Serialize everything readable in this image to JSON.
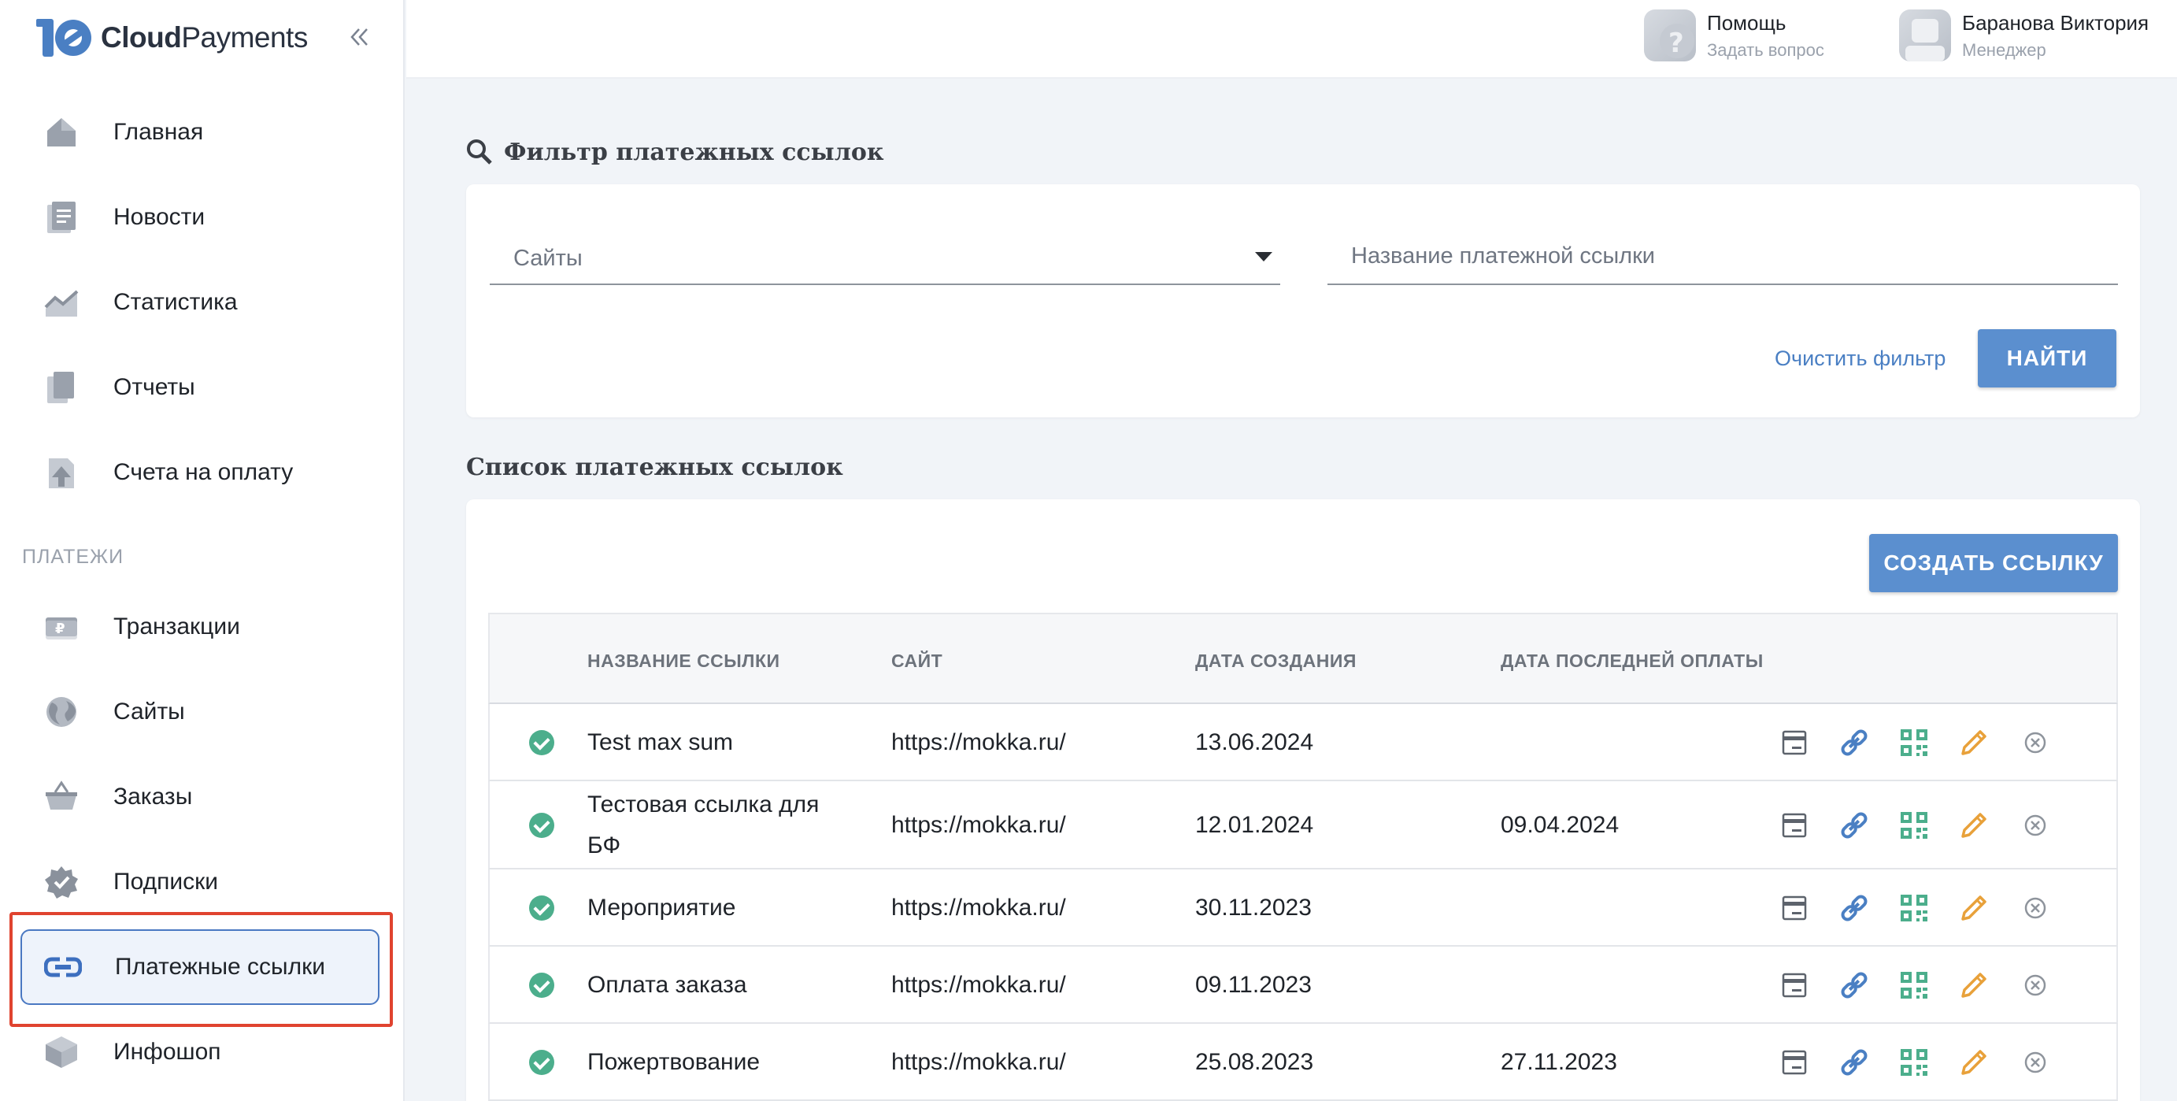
{
  "app": {
    "logo_bold": "Cloud",
    "logo_light": "Payments",
    "collapse_label": "«"
  },
  "sidebar": {
    "items_top": [
      {
        "label": "Главная",
        "icon": "home-icon"
      },
      {
        "label": "Новости",
        "icon": "news-icon"
      },
      {
        "label": "Статистика",
        "icon": "chart-icon"
      },
      {
        "label": "Отчеты",
        "icon": "reports-icon"
      },
      {
        "label": "Счета на оплату",
        "icon": "invoice-icon"
      }
    ],
    "section_payments": "ПЛАТЕЖИ",
    "items_payments": [
      {
        "label": "Транзакции",
        "icon": "transactions-icon"
      },
      {
        "label": "Сайты",
        "icon": "globe-icon"
      },
      {
        "label": "Заказы",
        "icon": "basket-icon"
      },
      {
        "label": "Подписки",
        "icon": "badge-icon"
      },
      {
        "label": "Платежные ссылки",
        "icon": "link-icon",
        "active": true
      },
      {
        "label": "Инфошоп",
        "icon": "box-icon"
      }
    ]
  },
  "topbar": {
    "help_title": "Помощь",
    "help_sub": "Задать вопрос",
    "user_name": "Баранова Виктория",
    "user_role": "Менеджер"
  },
  "filter": {
    "title": "Фильтр платежных ссылок",
    "sites_placeholder": "Сайты",
    "name_placeholder": "Название платежной ссылки",
    "clear_label": "Очистить фильтр",
    "find_label": "НАЙТИ"
  },
  "list": {
    "title": "Список платежных ссылок",
    "create_label": "СОЗДАТЬ ССЫЛКУ",
    "columns": [
      "НАЗВАНИЕ ССЫЛКИ",
      "САЙТ",
      "ДАТА СОЗДАНИЯ",
      "ДАТА ПОСЛЕДНЕЙ ОПЛАТЫ"
    ],
    "rows": [
      {
        "name": "Test max sum",
        "site": "https://mokka.ru/",
        "created": "13.06.2024",
        "last_paid": ""
      },
      {
        "name": "Тестовая ссылка для БФ",
        "site": "https://mokka.ru/",
        "created": "12.01.2024",
        "last_paid": "09.04.2024"
      },
      {
        "name": "Мероприятие",
        "site": "https://mokka.ru/",
        "created": "30.11.2023",
        "last_paid": ""
      },
      {
        "name": "Оплата заказа",
        "site": "https://mokka.ru/",
        "created": "09.11.2023",
        "last_paid": ""
      },
      {
        "name": "Пожертвование",
        "site": "https://mokka.ru/",
        "created": "25.08.2023",
        "last_paid": "27.11.2023"
      }
    ],
    "row_actions": [
      "card-icon",
      "link-icon",
      "qr-icon",
      "edit-pencil-icon",
      "delete-circle-icon"
    ],
    "colors": {
      "accent": "#5b8fcf",
      "status_ok": "#4cae8c",
      "link_icon": "#4a7fc3",
      "qr_icon": "#4cae8c",
      "edit_icon": "#e8a13a",
      "delete_icon": "#8e949c"
    }
  }
}
